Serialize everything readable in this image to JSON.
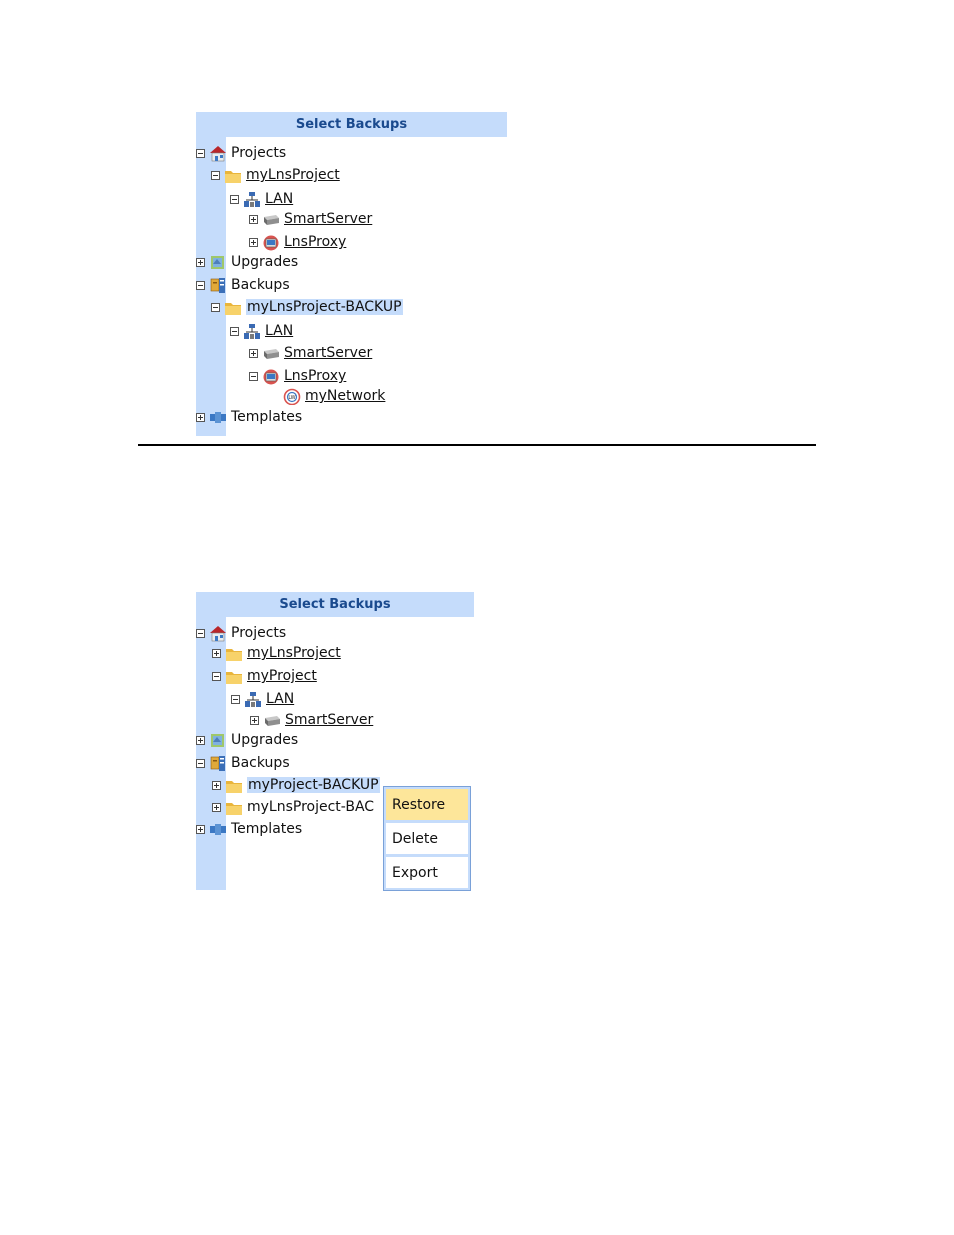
{
  "panel_top": {
    "header": "Select Backups",
    "tree": {
      "projects": "Projects",
      "mylnsproject": "myLnsProject",
      "lan": "LAN",
      "smartserver": "SmartServer",
      "lnsproxy": "LnsProxy",
      "upgrades": "Upgrades",
      "backups": "Backups",
      "backup_item": "myLnsProject-BACKUP",
      "backup_lan": "LAN",
      "backup_smartserver": "SmartServer",
      "backup_lnsproxy": "LnsProxy",
      "backup_network": "myNetwork",
      "templates": "Templates"
    }
  },
  "panel_bottom": {
    "header": "Select Backups",
    "tree": {
      "projects": "Projects",
      "mylnsproject": "myLnsProject",
      "myproject": "myProject",
      "lan": "LAN",
      "smartserver": "SmartServer",
      "upgrades": "Upgrades",
      "backups": "Backups",
      "backup_myproject": "myProject-BACKUP",
      "backup_mylnsproject": "myLnsProject-BAC",
      "templates": "Templates"
    },
    "context_menu": {
      "restore": "Restore",
      "delete": "Delete",
      "export": "Export"
    }
  },
  "colors": {
    "panel_blue": "#c5dcfb",
    "header_text": "#1a4a8e",
    "menu_highlight": "#fde69a"
  },
  "icons": [
    "house-icon",
    "folder-icon",
    "network-icon",
    "server-icon",
    "proxy-icon",
    "upgrades-icon",
    "backups-icon",
    "templates-icon",
    "lon-network-icon"
  ]
}
